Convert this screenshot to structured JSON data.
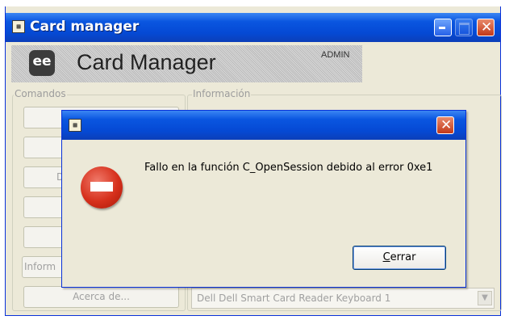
{
  "main_window": {
    "title": "Card manager",
    "app_icon": "card-reader-icon",
    "banner": {
      "title": "Card Manager",
      "role": "ADMIN",
      "logo_text": "ee"
    },
    "commands_group": {
      "label": "Comandos",
      "buttons": [
        "",
        "",
        "D",
        "",
        "",
        "Inform"
      ],
      "about_button": "Acerca de..."
    },
    "info_group": {
      "label": "Información",
      "reader_select_value": "Dell Dell Smart Card Reader Keyboard 1"
    }
  },
  "dialog": {
    "app_icon": "card-reader-icon",
    "message": "Fallo en la función C_OpenSession debido al error 0xe1",
    "icon": "error-stop-icon",
    "close_button_mnemonic": "C",
    "close_button_rest": "errar"
  },
  "colors": {
    "titlebar": "#0a56e0",
    "window_bg": "#ece9d8",
    "close_button": "#d6401e",
    "error_icon": "#d6301c"
  }
}
